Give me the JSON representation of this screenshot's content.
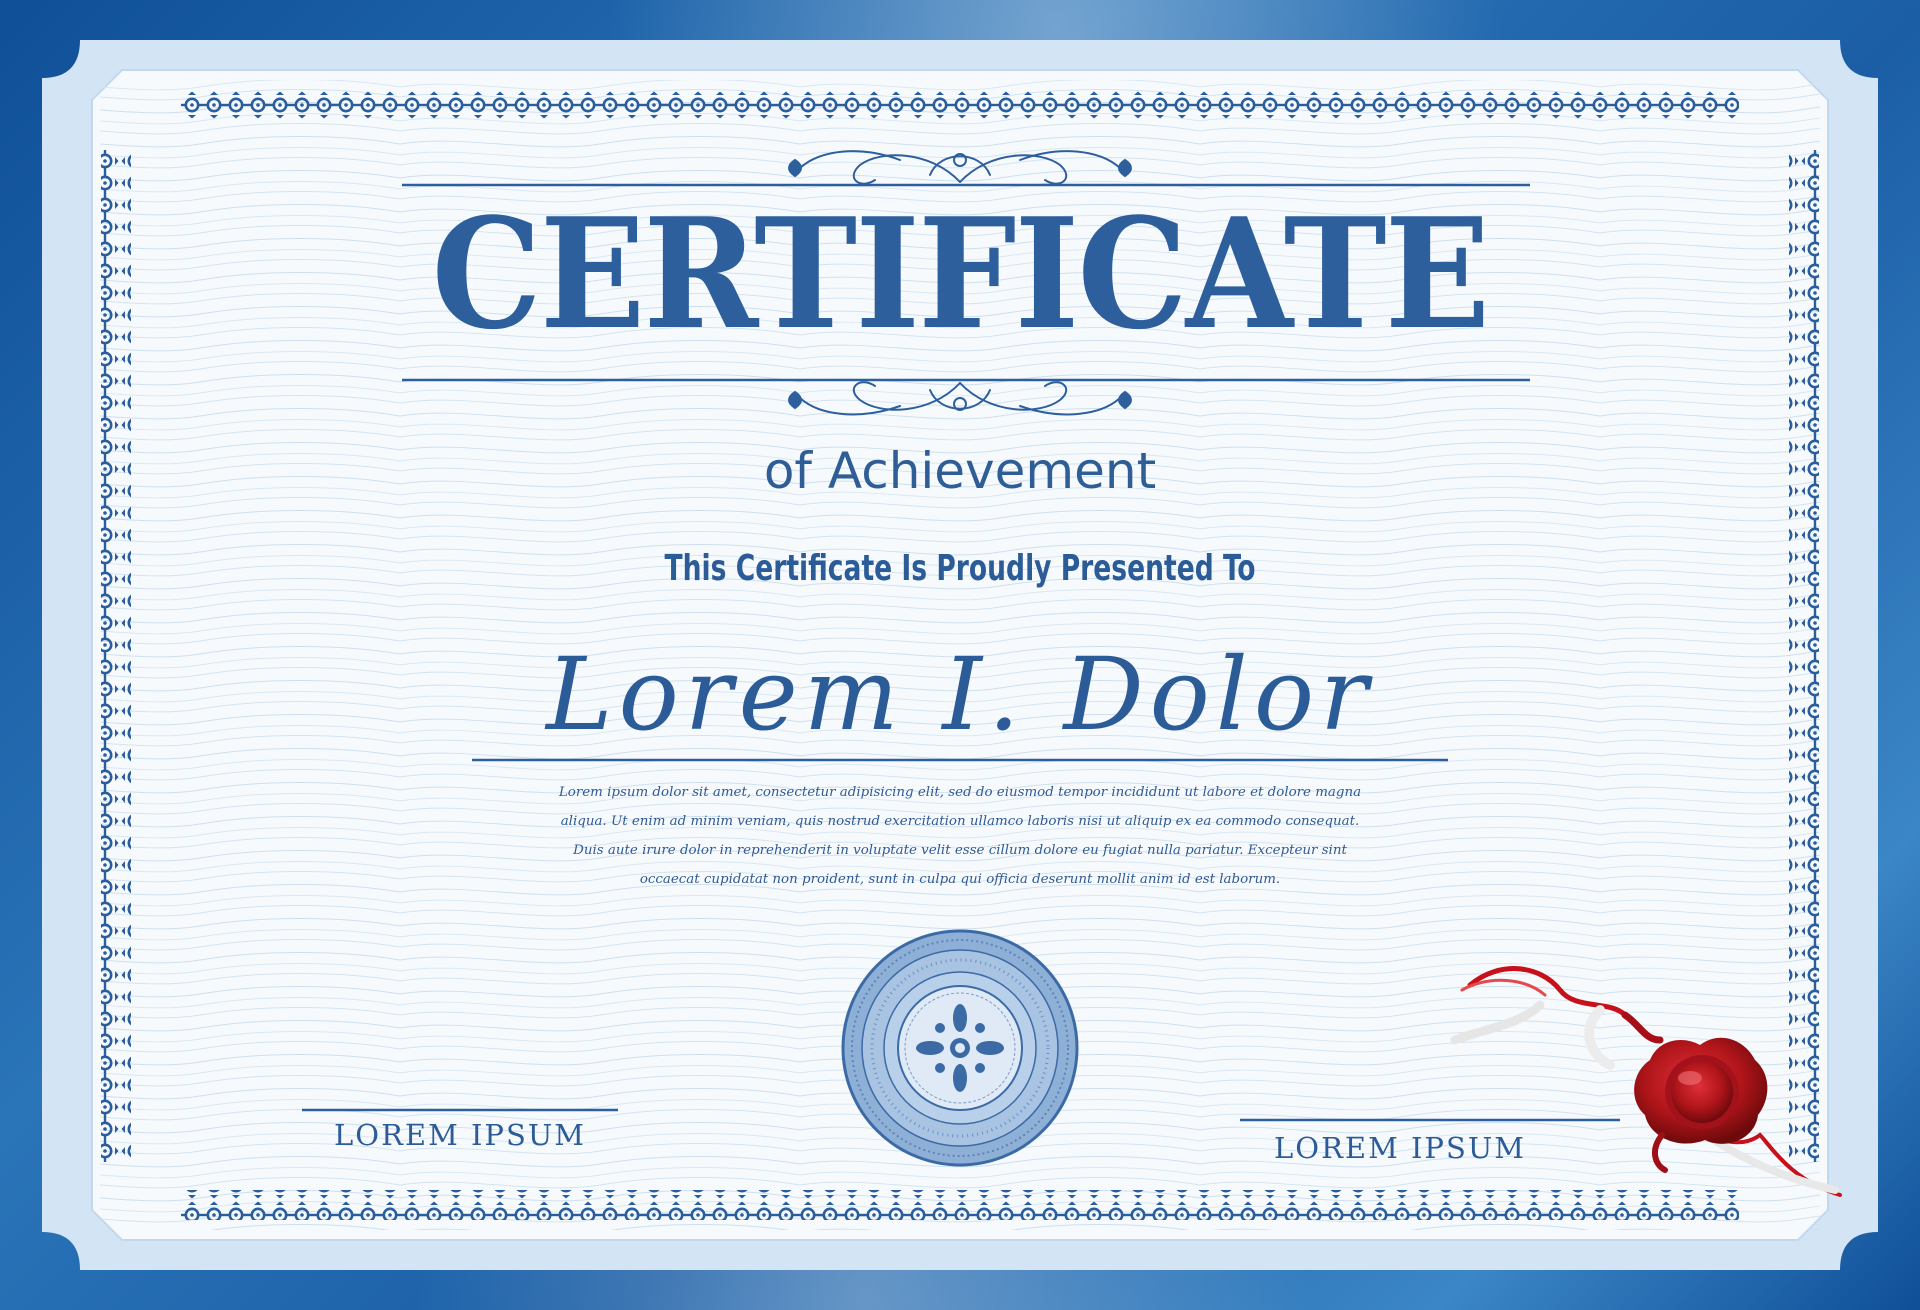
{
  "certificate": {
    "title": "CERTIFICATE",
    "subtitle": "of Achievement",
    "presented_line": "This Certificate Is Proudly Presented To",
    "recipient_name": "Lorem I. Dolor",
    "body_lines": [
      "Lorem ipsum dolor sit amet, consectetur adipisicing elit, sed do eiusmod tempor incididunt ut labore et dolore magna",
      "aliqua. Ut enim ad minim veniam, quis nostrud exercitation ullamco laboris nisi ut aliquip ex ea commodo consequat.",
      "Duis aute irure dolor in reprehenderit in voluptate velit esse cillum dolore eu fugiat nulla pariatur. Excepteur sint",
      "occaecat cupidatat non proident, sunt in culpa qui officia deserunt mollit anim id est laborum."
    ],
    "signature_left": "LOREM IPSUM",
    "signature_right": "LOREM IPSUM"
  },
  "colors": {
    "frame_blue": "#1a5aa0",
    "panel_light_blue": "#d3e5f5",
    "paper": "#f7fafd",
    "ink_blue": "#2c5f9e",
    "wax_seal_red": "#b0151a"
  },
  "icons": [
    "flourish-ornament-icon",
    "rosette-seal-icon",
    "wax-seal-icon",
    "ribbon-icon",
    "chain-border-icon"
  ]
}
